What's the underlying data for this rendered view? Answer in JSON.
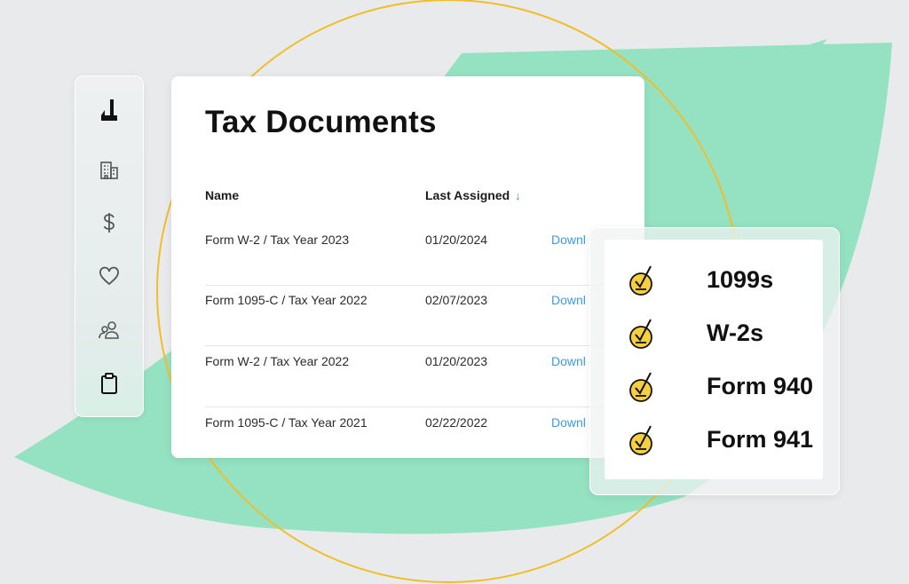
{
  "colors": {
    "background": "#e9eaeb",
    "mint": "#94e2c2",
    "ring": "#f0be2c",
    "link": "#3c9be0",
    "check_circle": "#f5d03c"
  },
  "sidebar": {
    "items": [
      {
        "icon": "logo-j-icon"
      },
      {
        "icon": "building-icon"
      },
      {
        "icon": "dollar-icon"
      },
      {
        "icon": "heart-icon"
      },
      {
        "icon": "people-icon"
      },
      {
        "icon": "clipboard-icon"
      }
    ]
  },
  "main": {
    "title": "Tax Documents",
    "columns": {
      "name": "Name",
      "last_assigned": "Last Assigned",
      "sort_indicator": "↓"
    },
    "rows": [
      {
        "name": "Form W-2 / Tax Year 2023",
        "date": "01/20/2024",
        "action": "Downl"
      },
      {
        "name": "Form 1095-C / Tax Year 2022",
        "date": "02/07/2023",
        "action": "Downl"
      },
      {
        "name": "Form W-2 / Tax Year 2022",
        "date": "01/20/2023",
        "action": "Downl"
      },
      {
        "name": "Form 1095-C / Tax Year 2021",
        "date": "02/22/2022",
        "action": "Downl"
      }
    ]
  },
  "overlay": {
    "items": [
      {
        "label": "1099s",
        "icon": "check-circle-icon"
      },
      {
        "label": "W-2s",
        "icon": "check-circle-icon"
      },
      {
        "label": "Form 940",
        "icon": "check-circle-icon"
      },
      {
        "label": "Form 941",
        "icon": "check-circle-icon"
      }
    ]
  }
}
